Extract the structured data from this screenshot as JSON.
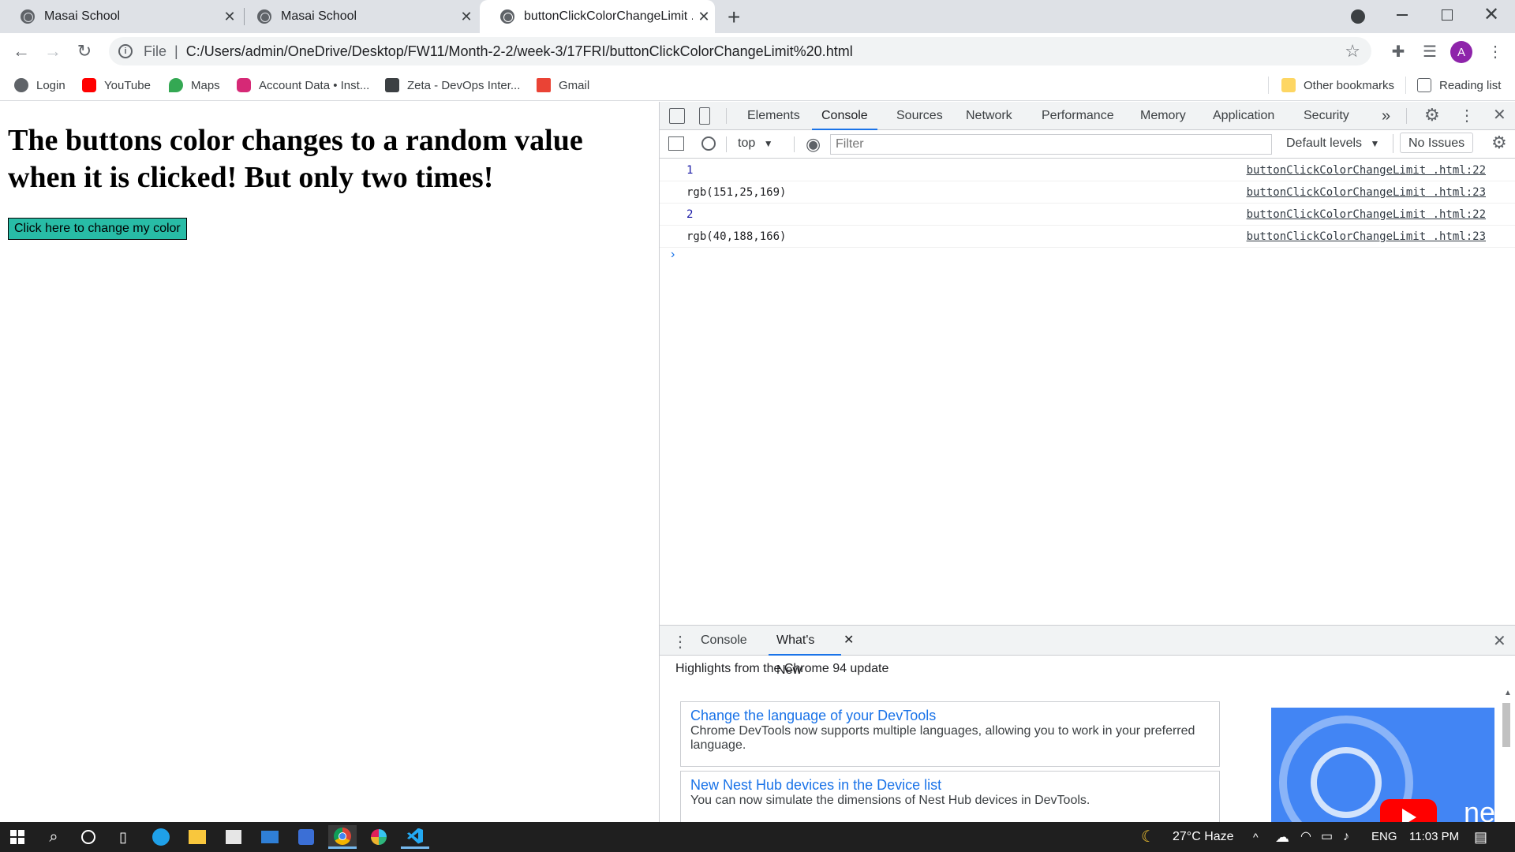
{
  "browser": {
    "tabs": [
      {
        "title": "Masai School",
        "close": "✕"
      },
      {
        "title": "Masai School",
        "close": "✕"
      },
      {
        "title": "buttonClickColorChangeLimit .html",
        "close": "✕"
      }
    ],
    "new_tab": "+",
    "address": {
      "scheme": "File",
      "url": "C:/Users/admin/OneDrive/Desktop/FW11/Month-2-2/week-3/17FRI/buttonClickColorChangeLimit%20.html"
    },
    "avatar_letter": "A",
    "bookmarks": [
      {
        "label": "Login",
        "icon": "globe-icon"
      },
      {
        "label": "YouTube",
        "icon": "youtube-icon"
      },
      {
        "label": "Maps",
        "icon": "maps-icon"
      },
      {
        "label": "Account Data • Inst...",
        "icon": "instagram-icon"
      },
      {
        "label": "Zeta - DevOps Inter...",
        "icon": "zeta-icon"
      },
      {
        "label": "Gmail",
        "icon": "gmail-icon"
      }
    ],
    "other_bookmarks": "Other bookmarks",
    "reading_list": "Reading list"
  },
  "page": {
    "heading": "The buttons color changes to a random value when it is clicked! But only two times!",
    "button_label": "Click here to change my color",
    "button_color": "#28bca6"
  },
  "devtools": {
    "tabs": [
      "Elements",
      "Console",
      "Sources",
      "Network",
      "Performance",
      "Memory",
      "Application",
      "Security"
    ],
    "more": "»",
    "context": "top",
    "filter_placeholder": "Filter",
    "levels": "Default levels",
    "issues": "No Issues",
    "console": [
      {
        "message": "1",
        "kind": "num",
        "source": "buttonClickColorChangeLimit .html:22"
      },
      {
        "message": "rgb(151,25,169)",
        "kind": "str",
        "source": "buttonClickColorChangeLimit .html:23"
      },
      {
        "message": "2",
        "kind": "num",
        "source": "buttonClickColorChangeLimit .html:22"
      },
      {
        "message": "rgb(40,188,166)",
        "kind": "str",
        "source": "buttonClickColorChangeLimit .html:23"
      }
    ],
    "prompt": "›",
    "drawer": {
      "tabs": [
        "Console",
        "What's New"
      ],
      "header": "Highlights from the Chrome 94 update",
      "cards": [
        {
          "title": "Change the language of your DevTools",
          "desc": "Chrome DevTools now supports multiple languages, allowing you to work in your preferred language."
        },
        {
          "title": "New Nest Hub devices in the Device list",
          "desc": "You can now simulate the dimensions of Nest Hub devices in DevTools."
        }
      ],
      "video_text": "ne"
    }
  },
  "taskbar": {
    "weather": "27°C  Haze",
    "language": "ENG",
    "time": "11:03 PM"
  }
}
